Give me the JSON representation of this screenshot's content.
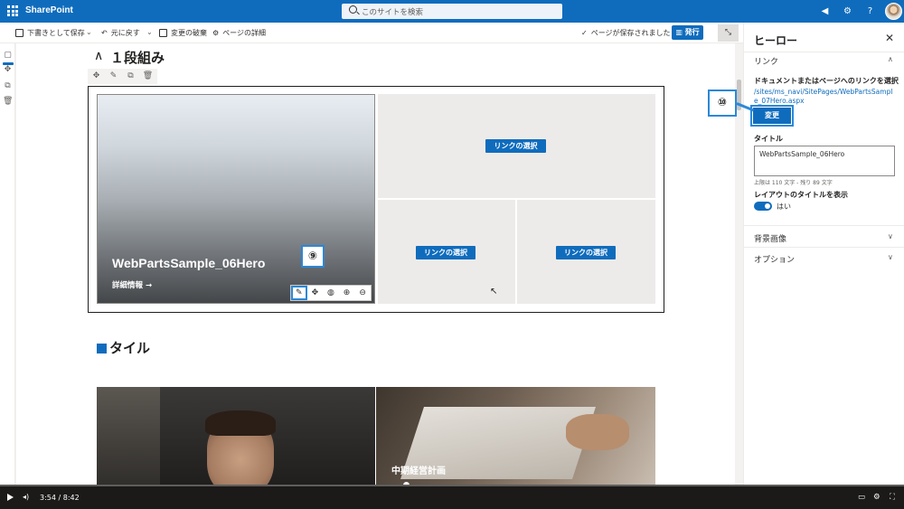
{
  "suite": {
    "brand": "SharePoint",
    "search_placeholder": "このサイトを検索"
  },
  "command_bar": {
    "save_draft": "下書きとして保存",
    "undo": "元に戻す",
    "discard": "変更の破棄",
    "page_details": "ページの詳細",
    "saved_status": "ページが保存されました",
    "publish": "発行"
  },
  "canvas": {
    "section_title": "１段組み",
    "hero": {
      "main_title": "WebPartsSample_06Hero",
      "main_link": "詳細情報 →",
      "select_link": "リンクの選択"
    },
    "tile_section_title": "タイル",
    "photo2_caption": "中期経営計画"
  },
  "callouts": {
    "nine": "⑨",
    "ten": "⑩"
  },
  "panel": {
    "title": "ヒーロー",
    "section_link": "リンク",
    "link_label": "ドキュメントまたはページへのリンクを選択",
    "link_path": "/sites/ms_navi/SitePages/WebPartsSample_07Hero.aspx",
    "change_button": "変更",
    "title_label": "タイトル",
    "title_value": "WebPartsSample_06Hero",
    "char_count": "上限は 110 文字 - 残り 89 文字",
    "show_title_label": "レイアウトのタイトルを表示",
    "toggle_value": "はい",
    "section_bg": "背景画像",
    "section_options": "オプション"
  },
  "player": {
    "time": "3:54 / 8:42"
  },
  "icons": [
    "waffle-icon",
    "search-icon",
    "megaphone-icon",
    "gear-icon",
    "help-icon",
    "save-icon",
    "undo-icon",
    "discard-icon",
    "details-icon",
    "check-icon",
    "publish-icon",
    "collapse-icon",
    "move-icon",
    "edit-icon",
    "duplicate-icon",
    "delete-icon",
    "close-icon",
    "chevron-up-icon",
    "chevron-down-icon",
    "play-icon",
    "volume-icon",
    "captions-icon",
    "settings-icon",
    "fullscreen-icon"
  ],
  "colors": {
    "accent": "#0f6cbd",
    "callout": "#2b88d8",
    "suite_bar": "#0f6cbd"
  }
}
